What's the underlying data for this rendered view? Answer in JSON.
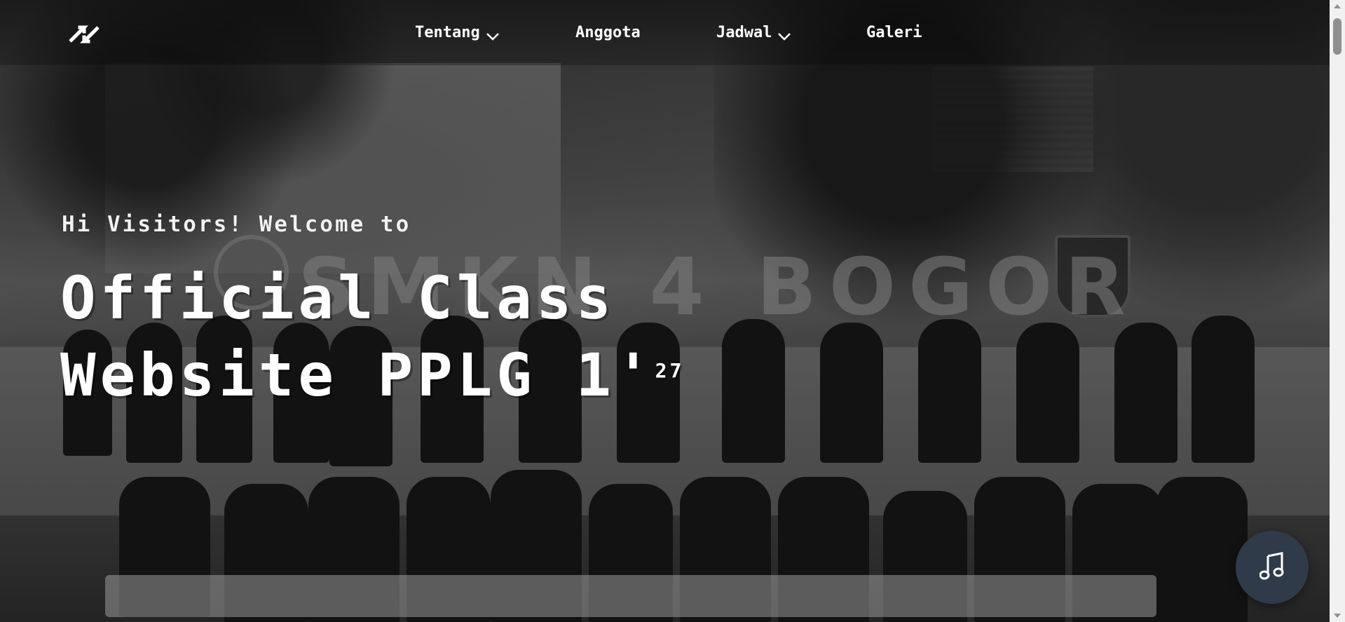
{
  "nav": {
    "brand_icon": "double-arrow-logo-icon",
    "items": [
      {
        "label": "Tentang",
        "has_dropdown": true
      },
      {
        "label": "Anggota",
        "has_dropdown": false
      },
      {
        "label": "Jadwal",
        "has_dropdown": true
      },
      {
        "label": "Galeri",
        "has_dropdown": false
      }
    ],
    "dropdown_icon": "chevron-down-icon"
  },
  "hero": {
    "kicker": "Hi Visitors! Welcome to",
    "title_line1": "Official Class",
    "title_line2": "Website PPLG 1'",
    "title_superscript": "27",
    "background_sign_text": "SMKN 4 BOGOR",
    "background": "grayscale-group-photo"
  },
  "music_button": {
    "icon": "music-note-icon",
    "background_color": "#2f3b49"
  },
  "colors": {
    "text": "#ffffff",
    "nav_bg": "rgba(0,0,0,0.35)"
  }
}
